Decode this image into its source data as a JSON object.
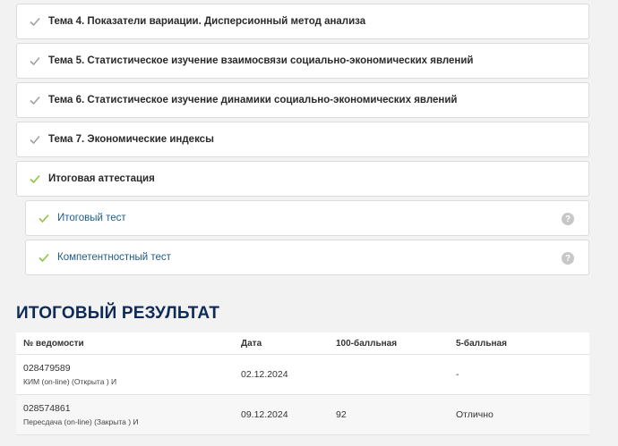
{
  "topics": [
    {
      "title": "Тема 4. Показатели вариации. Дисперсионный метод анализа",
      "done": false
    },
    {
      "title": "Тема 5. Статистическое изучение взаимосвязи социально-экономических явлений",
      "done": false
    },
    {
      "title": "Тема 6. Статистическое изучение динамики социально-экономических явлений",
      "done": false
    },
    {
      "title": "Тема 7. Экономические индексы",
      "done": false
    },
    {
      "title": "Итоговая аттестация",
      "done": true
    }
  ],
  "subitems": [
    {
      "title": "Итоговый тест",
      "help": "?"
    },
    {
      "title": "Компетентностный тест",
      "help": "?"
    }
  ],
  "result": {
    "heading": "ИТОГОВЫЙ РЕЗУЛЬТАТ",
    "columns": [
      "№ ведомости",
      "Дата",
      "100-балльная",
      "5-балльная"
    ],
    "rows": [
      {
        "number": "028479589",
        "type": "КИМ (on-line) (Открыта ) И",
        "date": "02.12.2024",
        "score100": "",
        "score5": "-"
      },
      {
        "number": "028574861",
        "type": "Пересдача (on-line) (Закрыта ) И",
        "date": "09.12.2024",
        "score100": "92",
        "score5": "Отлично"
      }
    ]
  },
  "colors": {
    "check_done": "#8cc63f",
    "check_pending": "#a0a0a0",
    "heading": "#0f2a57",
    "link": "#1e5b8a"
  }
}
